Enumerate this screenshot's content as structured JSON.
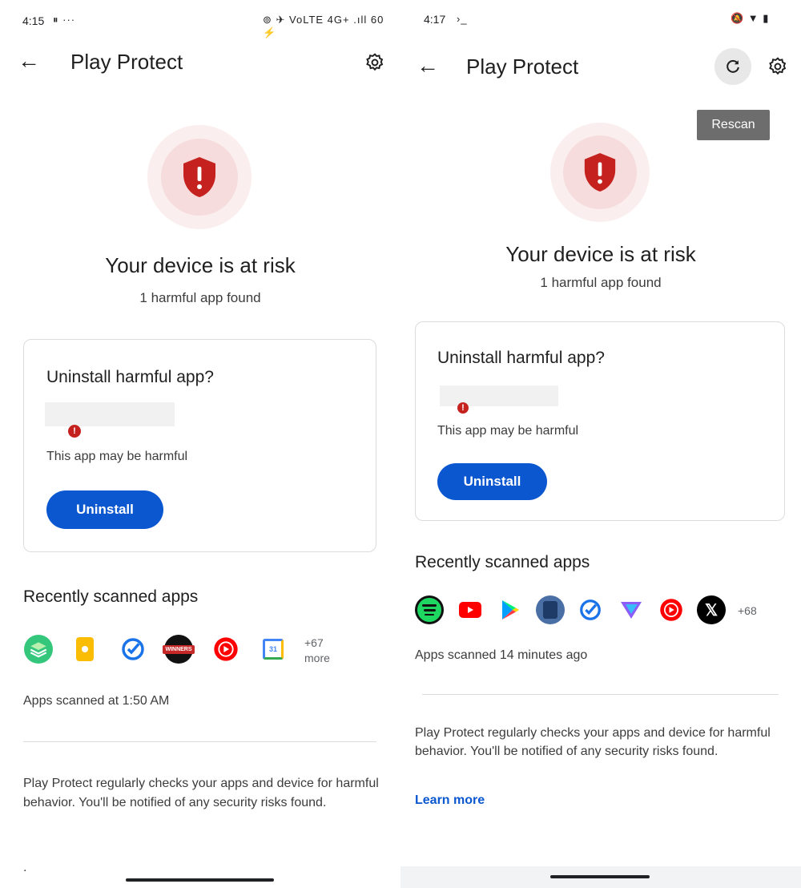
{
  "left": {
    "status": {
      "time": "4:15",
      "extra": "⏸ ···",
      "right": "⊚ ✈ VoLTE 4G+ .ıll 60 ⚡"
    },
    "title": "Play Protect",
    "headline": "Your device is at risk",
    "subline": "1 harmful app found",
    "card": {
      "title": "Uninstall harmful app?",
      "warning": "This app may be harmful",
      "button": "Uninstall"
    },
    "recent": {
      "title": "Recently scanned apps",
      "apps": [
        "layers-app-icon",
        "keep-notes-icon",
        "tasks-check-icon",
        "winners-app-icon",
        "youtube-music-icon",
        "calendar-icon"
      ],
      "calendar_day": "31",
      "winners_label": "WINNERS",
      "more_line1": "+67",
      "more_line2": "more"
    },
    "scanned": "Apps scanned at 1:50 AM",
    "info": "Play Protect regularly checks your apps and device for harmful behavior. You'll be notified of any security risks found.",
    "dot": "."
  },
  "right": {
    "status": {
      "time": "4:17",
      "extra": "›_",
      "right": "🔕 ▼ ▮"
    },
    "title": "Play Protect",
    "tooltip": "Rescan",
    "headline": "Your device is at risk",
    "subline": "1 harmful app found",
    "card": {
      "title": "Uninstall harmful app?",
      "warning": "This app may be harmful",
      "button": "Uninstall"
    },
    "recent": {
      "title": "Recently scanned apps",
      "apps": [
        "spotify-icon",
        "youtube-icon",
        "play-store-icon",
        "generic-app-icon",
        "tasks-check-icon",
        "proton-vpn-icon",
        "youtube-music-icon",
        "x-icon"
      ],
      "x_label": "𝕏",
      "more": "+68"
    },
    "scanned": "Apps scanned 14 minutes ago",
    "info": "Play Protect regularly checks your apps and device for harmful behavior. You'll be notified of any security risks found.",
    "learn_more": "Learn more"
  },
  "colors": {
    "accent": "#0b57d0",
    "danger": "#c5221f",
    "halo_outer": "#fbeeee",
    "halo_inner": "#f6dcdc"
  }
}
